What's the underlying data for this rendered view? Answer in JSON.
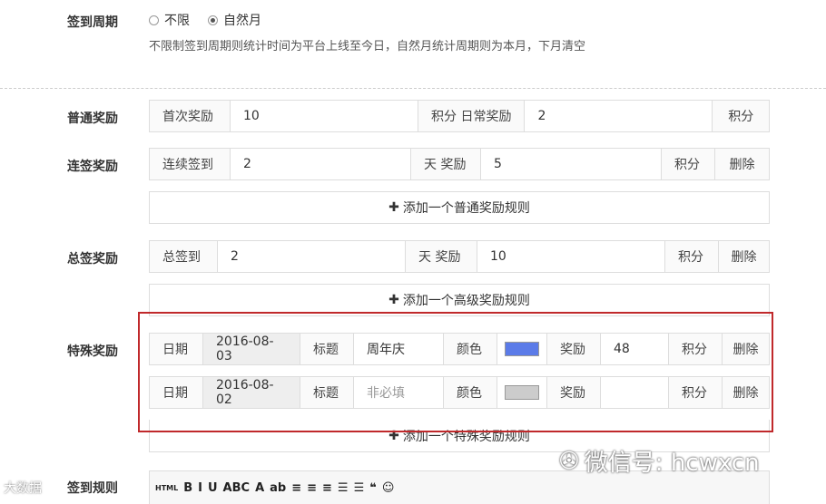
{
  "cycle": {
    "label": "签到周期",
    "opt1": "不限",
    "opt2": "自然月",
    "hint": "不限制签到周期则统计时间为平台上线至今日，自然月统计周期则为本月，下月清空"
  },
  "normal": {
    "label": "普通奖励",
    "first_label": "首次奖励",
    "first_value": "10",
    "mid": "积分 日常奖励",
    "daily_value": "2",
    "unit": "积分"
  },
  "consecutive": {
    "label": "连签奖励",
    "prefix": "连续签到",
    "days": "2",
    "mid": "天 奖励",
    "points": "5",
    "unit": "积分",
    "delete": "删除"
  },
  "add_normal": "添加一个普通奖励规则",
  "total": {
    "label": "总签奖励",
    "prefix": "总签到",
    "days": "2",
    "mid": "天 奖励",
    "points": "10",
    "unit": "积分",
    "delete": "删除"
  },
  "add_advanced": "添加一个高级奖励规则",
  "special": {
    "label": "特殊奖励",
    "rows": [
      {
        "date_label": "日期",
        "date": "2016-08-03",
        "title_label": "标题",
        "title": "周年庆",
        "color_label": "颜色",
        "color": "#5b7be8",
        "reward_label": "奖励",
        "reward": "48",
        "unit": "积分",
        "delete": "删除"
      },
      {
        "date_label": "日期",
        "date": "2016-08-02",
        "title_label": "标题",
        "title_placeholder": "非必填",
        "color_label": "颜色",
        "color": "#cccccc",
        "reward_label": "奖励",
        "reward": "",
        "unit": "积分",
        "delete": "删除"
      }
    ]
  },
  "add_special": "添加一个特殊奖励规则",
  "rules_label": "签到规则",
  "toolbar_items": [
    "HTML",
    "B",
    "I",
    "U",
    "ABC",
    "A",
    "ab",
    "≡",
    "≡",
    "≡",
    "☰",
    "☰",
    "❝",
    "☺"
  ],
  "watermark": "微信号: hcwxcn",
  "watermark_left": "大数据"
}
